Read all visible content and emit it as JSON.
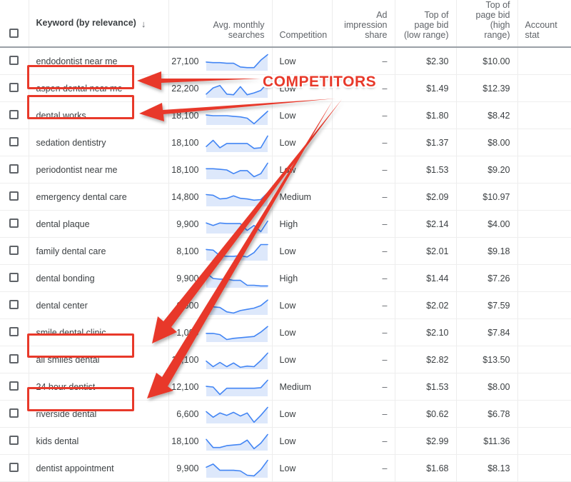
{
  "table": {
    "columns": [
      {
        "key": "check",
        "label": "",
        "align": "center"
      },
      {
        "key": "keyword",
        "label": "Keyword (by relevance)",
        "align": "left",
        "sort_icon": "arrow-down-icon"
      },
      {
        "key": "volume",
        "label": "Avg. monthly searches",
        "align": "right"
      },
      {
        "key": "competition",
        "label": "Competition",
        "align": "left"
      },
      {
        "key": "impression_share",
        "label": "Ad impression share",
        "align": "right"
      },
      {
        "key": "bid_low",
        "label": "Top of page bid (low range)",
        "align": "right"
      },
      {
        "key": "bid_high",
        "label": "Top of page bid (high range)",
        "align": "right"
      },
      {
        "key": "account_status",
        "label": "Account stat",
        "align": "left"
      }
    ],
    "rows": [
      {
        "keyword": "endodontist near me",
        "volume": "27,100",
        "competition": "Low",
        "impression_share": "–",
        "bid_low": "$2.30",
        "bid_high": "$10.00",
        "account_status": "",
        "highlight": false,
        "spark": [
          14,
          13,
          13,
          12,
          12,
          6,
          5,
          5,
          17,
          26
        ]
      },
      {
        "keyword": "aspen dental near me",
        "volume": "22,200",
        "competition": "Low",
        "impression_share": "–",
        "bid_low": "$1.49",
        "bid_high": "$12.39",
        "account_status": "",
        "highlight": true,
        "spark": [
          6,
          16,
          20,
          6,
          5,
          18,
          5,
          8,
          12,
          24
        ]
      },
      {
        "keyword": "dental works",
        "volume": "18,100",
        "competition": "Low",
        "impression_share": "–",
        "bid_low": "$1.80",
        "bid_high": "$8.42",
        "account_status": "",
        "highlight": true,
        "spark": [
          16,
          15,
          15,
          15,
          14,
          13,
          11,
          2,
          12,
          22
        ]
      },
      {
        "keyword": "sedation dentistry",
        "volume": "18,100",
        "competition": "Low",
        "impression_share": "–",
        "bid_low": "$1.37",
        "bid_high": "$8.00",
        "account_status": "",
        "highlight": false,
        "spark": [
          9,
          19,
          7,
          14,
          14,
          14,
          14,
          6,
          7,
          26
        ]
      },
      {
        "keyword": "periodontist near me",
        "volume": "18,100",
        "competition": "Low",
        "impression_share": "–",
        "bid_low": "$1.53",
        "bid_high": "$9.20",
        "account_status": "",
        "highlight": false,
        "spark": [
          17,
          17,
          16,
          15,
          9,
          14,
          14,
          4,
          9,
          26
        ]
      },
      {
        "keyword": "emergency dental care",
        "volume": "14,800",
        "competition": "Medium",
        "impression_share": "–",
        "bid_low": "$2.09",
        "bid_high": "$10.97",
        "account_status": "",
        "highlight": false,
        "spark": [
          19,
          18,
          12,
          13,
          17,
          13,
          12,
          10,
          11,
          22
        ]
      },
      {
        "keyword": "dental plaque",
        "volume": "9,900",
        "competition": "High",
        "impression_share": "–",
        "bid_low": "$2.14",
        "bid_high": "$4.00",
        "account_status": "",
        "highlight": false,
        "spark": [
          17,
          13,
          17,
          16,
          16,
          16,
          5,
          13,
          3,
          20
        ]
      },
      {
        "keyword": "family dental care",
        "volume": "8,100",
        "competition": "Low",
        "impression_share": "–",
        "bid_low": "$2.01",
        "bid_high": "$9.18",
        "account_status": "",
        "highlight": false,
        "spark": [
          18,
          17,
          8,
          7,
          7,
          8,
          6,
          13,
          26,
          26
        ]
      },
      {
        "keyword": "dental bonding",
        "volume": "9,900",
        "competition": "High",
        "impression_share": "–",
        "bid_low": "$1.44",
        "bid_high": "$7.26",
        "account_status": "",
        "highlight": false,
        "spark": [
          24,
          15,
          14,
          14,
          12,
          12,
          4,
          4,
          3,
          3
        ]
      },
      {
        "keyword": "dental center",
        "volume": "6,600",
        "competition": "Low",
        "impression_share": "–",
        "bid_low": "$2.02",
        "bid_high": "$7.59",
        "account_status": "",
        "highlight": false,
        "spark": [
          13,
          13,
          12,
          5,
          3,
          7,
          9,
          11,
          15,
          24
        ]
      },
      {
        "keyword": "smile dental clinic",
        "volume": "1,000",
        "competition": "Low",
        "impression_share": "–",
        "bid_low": "$2.10",
        "bid_high": "$7.84",
        "account_status": "",
        "highlight": false,
        "spark": [
          14,
          14,
          12,
          4,
          6,
          7,
          8,
          9,
          16,
          25
        ]
      },
      {
        "keyword": "all smiles dental",
        "volume": "12,100",
        "competition": "Low",
        "impression_share": "–",
        "bid_low": "$2.82",
        "bid_high": "$13.50",
        "account_status": "",
        "highlight": true,
        "spark": [
          13,
          4,
          11,
          4,
          10,
          3,
          5,
          4,
          14,
          26
        ]
      },
      {
        "keyword": "24 hour dentist",
        "volume": "12,100",
        "competition": "Medium",
        "impression_share": "–",
        "bid_low": "$1.53",
        "bid_high": "$8.00",
        "account_status": "",
        "highlight": false,
        "spark": [
          16,
          15,
          3,
          13,
          13,
          13,
          13,
          13,
          14,
          26
        ]
      },
      {
        "keyword": "riverside dental",
        "volume": "6,600",
        "competition": "Low",
        "impression_share": "–",
        "bid_low": "$0.62",
        "bid_high": "$6.78",
        "account_status": "",
        "highlight": true,
        "spark": [
          19,
          10,
          17,
          13,
          18,
          12,
          17,
          2,
          13,
          26
        ]
      },
      {
        "keyword": "kids dental",
        "volume": "18,100",
        "competition": "Low",
        "impression_share": "–",
        "bid_low": "$2.99",
        "bid_high": "$11.36",
        "account_status": "",
        "highlight": false,
        "spark": [
          18,
          5,
          5,
          8,
          9,
          10,
          17,
          3,
          12,
          26
        ]
      },
      {
        "keyword": "dentist appointment",
        "volume": "9,900",
        "competition": "Low",
        "impression_share": "–",
        "bid_low": "$1.68",
        "bid_high": "$8.13",
        "account_status": "",
        "highlight": false,
        "spark": [
          17,
          22,
          12,
          12,
          12,
          11,
          4,
          3,
          13,
          28
        ]
      }
    ]
  },
  "annotations": {
    "label": "COMPETITORS",
    "color": "#e8392a",
    "highlighted_keywords": [
      "aspen dental near me",
      "dental works",
      "all smiles dental",
      "riverside dental"
    ],
    "arrows": 4
  },
  "colors": {
    "accent_red": "#e8392a",
    "spark_line": "#4285f4",
    "spark_fill": "#dde8fb",
    "header_text": "#5f6368"
  }
}
